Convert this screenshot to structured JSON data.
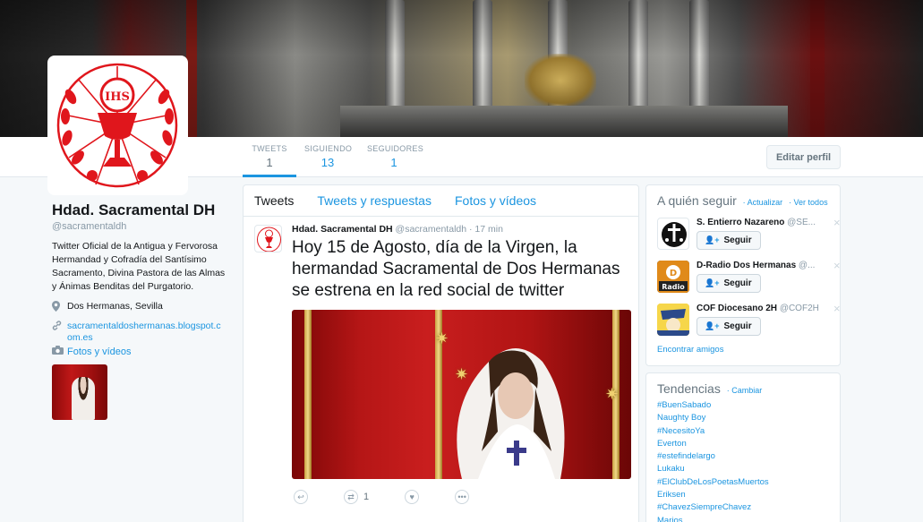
{
  "colors": {
    "accent": "#1b95e0",
    "seal_red": "#e0161c",
    "text_dark": "#14171a",
    "text_muted": "#8899a6"
  },
  "nav": {
    "stats": [
      {
        "label": "TWEETS",
        "value": "1"
      },
      {
        "label": "SIGUIENDO",
        "value": "13"
      },
      {
        "label": "SEGUIDORES",
        "value": "1"
      }
    ],
    "edit_profile": "Editar perfil"
  },
  "profile": {
    "name": "Hdad. Sacramental DH",
    "handle": "@sacramentaldh",
    "bio": "Twitter Oficial de la Antigua y Fervorosa Hermandad y Cofradía del Santísimo Sacramento, Divina Pastora de las Almas y Ánimas Benditas del Purgatorio.",
    "location": "Dos Hermanas, Sevilla",
    "website_line1": "sacramentaldoshermanas.blogspot.c",
    "website_line2": "om.es",
    "photos_link": "Fotos y vídeos"
  },
  "timeline": {
    "tabs": [
      "Tweets",
      "Tweets y respuestas",
      "Fotos y vídeos"
    ],
    "tweet": {
      "name": "Hdad. Sacramental DH",
      "handle": "@sacramentaldh",
      "time": "· 17 min",
      "text": "Hoy 15 de Agosto, día de la Virgen,  la hermandad Sacramental de Dos Hermanas se estrena en la red social de twitter",
      "retweet_count": "1"
    }
  },
  "who_to_follow": {
    "title": "A quién seguir",
    "refresh": "· Actualizar",
    "view_all": "· Ver todos",
    "follow_label": "Seguir",
    "suggestions": [
      {
        "name": "S. Entierro Nazareno",
        "handle": "@SE..."
      },
      {
        "name": "D-Radio Dos Hermanas",
        "handle": "@..."
      },
      {
        "name": "COF Diocesano 2H",
        "handle": "@COF2H"
      }
    ],
    "avatar_text": "Radio",
    "find_friends": "Encontrar amigos"
  },
  "trends": {
    "title": "Tendencias",
    "change": "· Cambiar",
    "items": [
      "#BuenSabado",
      "Naughty Boy",
      "#NecesitoYa",
      "Everton",
      "#estefindelargo",
      "Lukaku",
      "#ElClubDeLosPoetasMuertos",
      "Eriksen",
      "#ChavezSiempreChavez",
      "Marios"
    ]
  }
}
